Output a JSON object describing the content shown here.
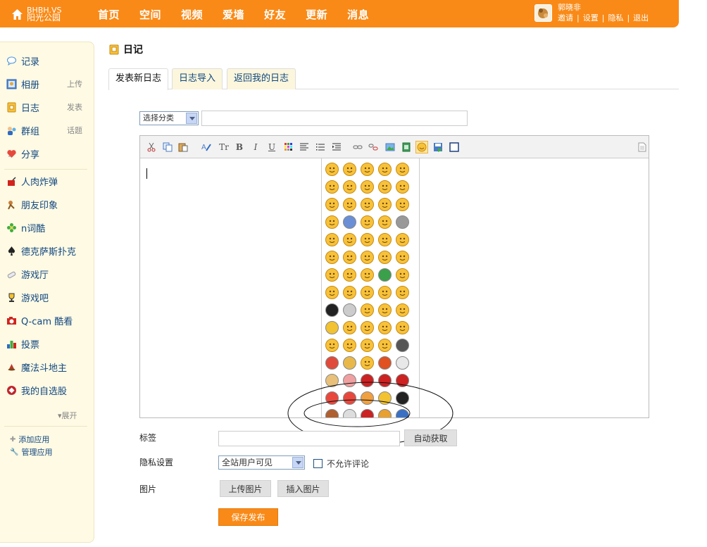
{
  "brand": {
    "line1": "BHBH.VS",
    "line2": "阳光公园"
  },
  "nav": [
    "首页",
    "空间",
    "视频",
    "爱墙",
    "好友",
    "更新",
    "消息"
  ],
  "user": {
    "name": "郭晓非",
    "links": [
      "邀请",
      "设置",
      "隐私",
      "退出"
    ]
  },
  "sidebar": {
    "items": [
      {
        "label": "记录",
        "sub": ""
      },
      {
        "label": "相册",
        "sub": "上传"
      },
      {
        "label": "日志",
        "sub": "发表"
      },
      {
        "label": "群组",
        "sub": "话题"
      },
      {
        "label": "分享",
        "sub": ""
      },
      {
        "label": "人肉炸弹",
        "sub": ""
      },
      {
        "label": "朋友印象",
        "sub": ""
      },
      {
        "label": "n词酷",
        "sub": ""
      },
      {
        "label": "德克萨斯扑克",
        "sub": ""
      },
      {
        "label": "游戏厅",
        "sub": ""
      },
      {
        "label": "游戏吧",
        "sub": ""
      },
      {
        "label": "Q-cam 酷看",
        "sub": ""
      },
      {
        "label": "投票",
        "sub": ""
      },
      {
        "label": "魔法斗地主",
        "sub": ""
      },
      {
        "label": "我的自选股",
        "sub": ""
      }
    ],
    "expand": "展开",
    "add_app": "添加应用",
    "manage_app": "管理应用"
  },
  "page": {
    "title": "日记",
    "tabs": [
      "发表新日志",
      "日志导入",
      "返回我的日志"
    ]
  },
  "form": {
    "category_select": "选择分类",
    "tag_label": "标签",
    "auto_fetch": "自动获取",
    "privacy_label": "隐私设置",
    "privacy_value": "全站用户可见",
    "no_comment": "不允许评论",
    "image_label": "图片",
    "upload_image": "上传图片",
    "insert_image": "插入图片",
    "save_publish": "保存发布"
  },
  "toolbar": {
    "icons": [
      "cut-icon",
      "copy-icon",
      "paste-icon",
      "format-icon",
      "font-size-icon",
      "bold-icon",
      "italic-icon",
      "underline-icon",
      "color-icon",
      "align-icon",
      "list-icon",
      "indent-icon",
      "link-icon",
      "unlink-icon",
      "image-icon",
      "video-icon",
      "emoticon-icon",
      "save-icon",
      "fullscreen-icon",
      "source-icon"
    ],
    "bold": "B",
    "italic": "I",
    "underline": "U",
    "font_size": "Tr"
  },
  "colors": {
    "brand": "#f98a17",
    "sidebar_bg": "#fefae4",
    "link": "#114780",
    "emoticon": "#f7c23a"
  }
}
